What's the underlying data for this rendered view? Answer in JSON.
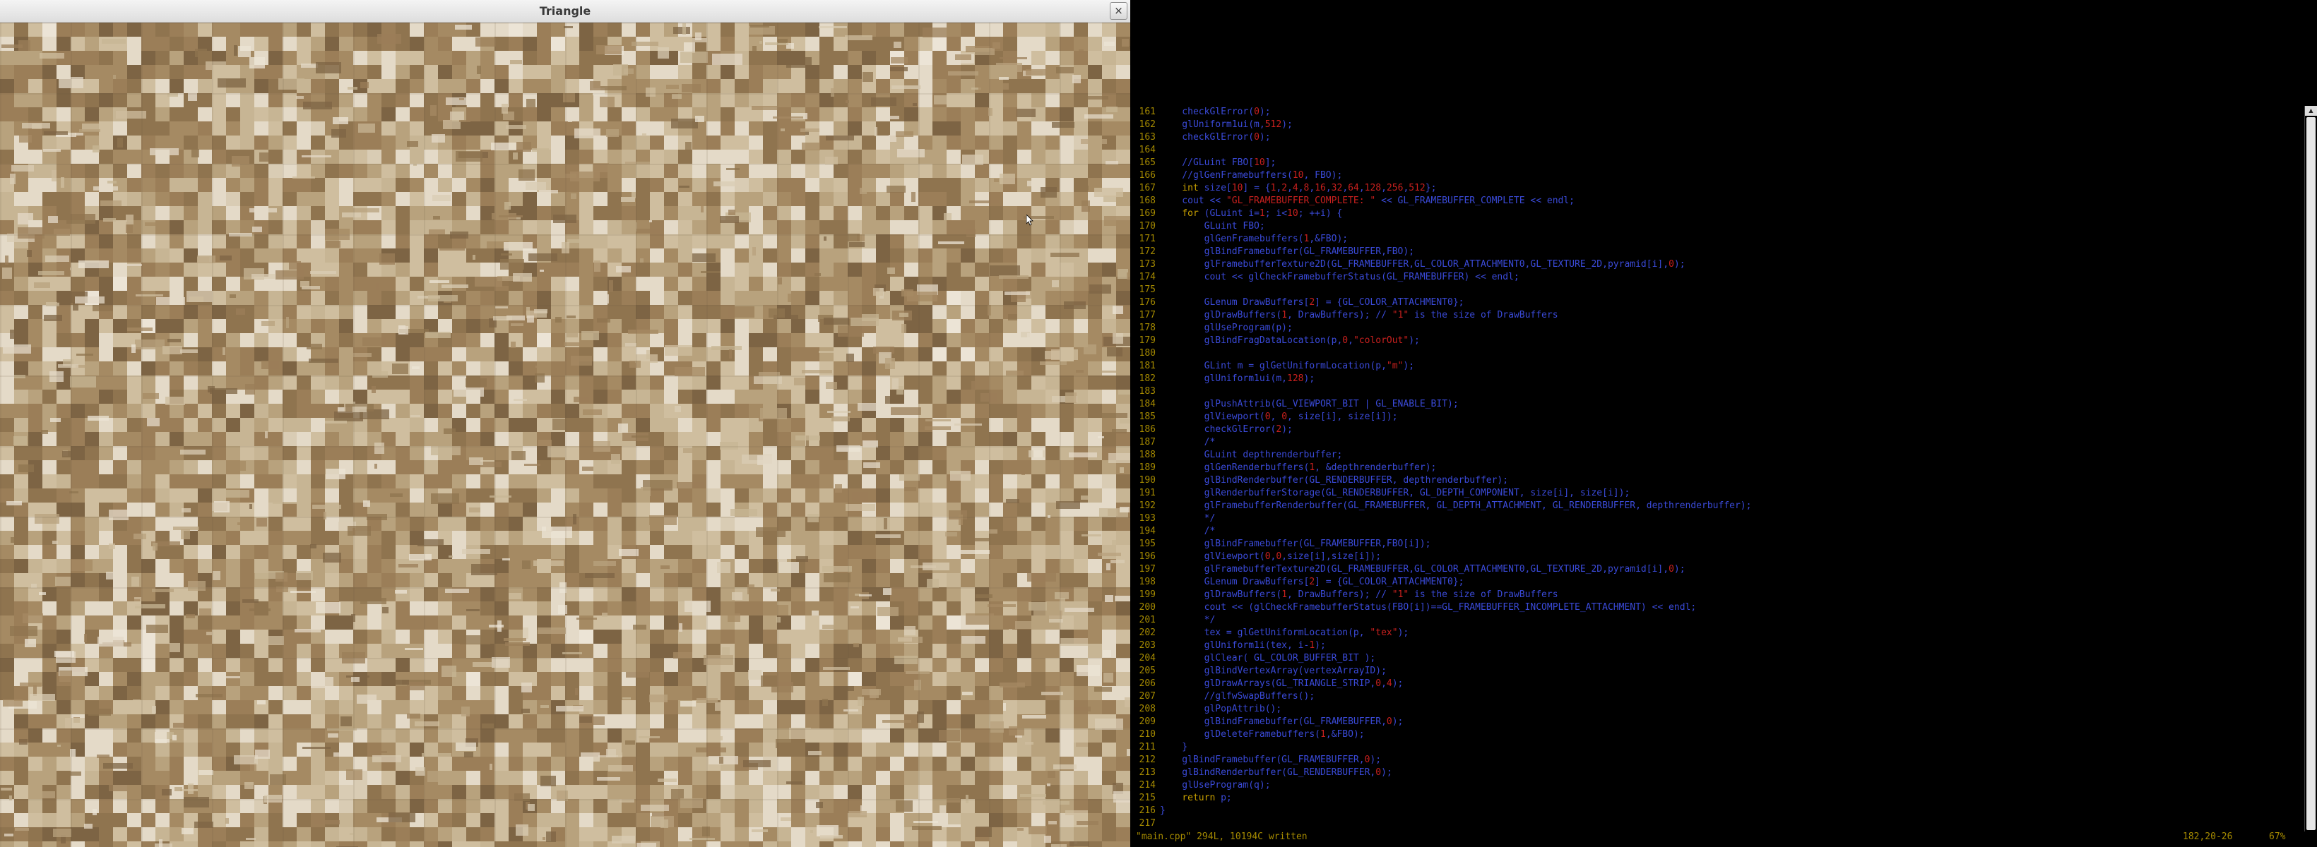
{
  "gl_window": {
    "title": "Triangle",
    "close_glyph": "×",
    "canvas_name": "Rendered texture pyramid output"
  },
  "editor": {
    "lines": [
      {
        "num": "161",
        "text": "    checkGlError(0);"
      },
      {
        "num": "162",
        "text": "    glUniform1ui(m,512);"
      },
      {
        "num": "163",
        "text": "    checkGlError(0);"
      },
      {
        "num": "164",
        "text": ""
      },
      {
        "num": "165",
        "text": "    //GLuint FBO[10];"
      },
      {
        "num": "166",
        "text": "    //glGenFramebuffers(10, FBO);"
      },
      {
        "num": "167",
        "text": "    int size[10] = {1,2,4,8,16,32,64,128,256,512};"
      },
      {
        "num": "168",
        "text": "    cout << \"GL_FRAMEBUFFER_COMPLETE: \" << GL_FRAMEBUFFER_COMPLETE << endl;"
      },
      {
        "num": "169",
        "text": "    for (GLuint i=1; i<10; ++i) {"
      },
      {
        "num": "170",
        "text": "        GLuint FBO;"
      },
      {
        "num": "171",
        "text": "        glGenFramebuffers(1,&FBO);"
      },
      {
        "num": "172",
        "text": "        glBindFramebuffer(GL_FRAMEBUFFER,FBO);"
      },
      {
        "num": "173",
        "text": "        glFramebufferTexture2D(GL_FRAMEBUFFER,GL_COLOR_ATTACHMENT0,GL_TEXTURE_2D,pyramid[i],0);"
      },
      {
        "num": "174",
        "text": "        cout << glCheckFramebufferStatus(GL_FRAMEBUFFER) << endl;"
      },
      {
        "num": "175",
        "text": ""
      },
      {
        "num": "176",
        "text": "        GLenum DrawBuffers[2] = {GL_COLOR_ATTACHMENT0};"
      },
      {
        "num": "177",
        "text": "        glDrawBuffers(1, DrawBuffers); // \"1\" is the size of DrawBuffers"
      },
      {
        "num": "178",
        "text": "        glUseProgram(p);"
      },
      {
        "num": "179",
        "text": "        glBindFragDataLocation(p,0,\"colorOut\");"
      },
      {
        "num": "180",
        "text": ""
      },
      {
        "num": "181",
        "text": "        GLint m = glGetUniformLocation(p,\"m\");"
      },
      {
        "num": "182",
        "text": "        glUniform1ui(m,128);"
      },
      {
        "num": "183",
        "text": ""
      },
      {
        "num": "184",
        "text": "        glPushAttrib(GL_VIEWPORT_BIT | GL_ENABLE_BIT);"
      },
      {
        "num": "185",
        "text": "        glViewport(0, 0, size[i], size[i]);"
      },
      {
        "num": "186",
        "text": "        checkGlError(2);"
      },
      {
        "num": "187",
        "text": "        /*"
      },
      {
        "num": "188",
        "text": "        GLuint depthrenderbuffer;"
      },
      {
        "num": "189",
        "text": "        glGenRenderbuffers(1, &depthrenderbuffer);"
      },
      {
        "num": "190",
        "text": "        glBindRenderbuffer(GL_RENDERBUFFER, depthrenderbuffer);"
      },
      {
        "num": "191",
        "text": "        glRenderbufferStorage(GL_RENDERBUFFER, GL_DEPTH_COMPONENT, size[i], size[i]);"
      },
      {
        "num": "192",
        "text": "        glFramebufferRenderbuffer(GL_FRAMEBUFFER, GL_DEPTH_ATTACHMENT, GL_RENDERBUFFER, depthrenderbuffer);"
      },
      {
        "num": "193",
        "text": "        */"
      },
      {
        "num": "194",
        "text": "        /*"
      },
      {
        "num": "195",
        "text": "        glBindFramebuffer(GL_FRAMEBUFFER,FBO[i]);"
      },
      {
        "num": "196",
        "text": "        glViewport(0,0,size[i],size[i]);"
      },
      {
        "num": "197",
        "text": "        glFramebufferTexture2D(GL_FRAMEBUFFER,GL_COLOR_ATTACHMENT0,GL_TEXTURE_2D,pyramid[i],0);"
      },
      {
        "num": "198",
        "text": "        GLenum DrawBuffers[2] = {GL_COLOR_ATTACHMENT0};"
      },
      {
        "num": "199",
        "text": "        glDrawBuffers(1, DrawBuffers); // \"1\" is the size of DrawBuffers"
      },
      {
        "num": "200",
        "text": "        cout << (glCheckFramebufferStatus(FBO[i])==GL_FRAMEBUFFER_INCOMPLETE_ATTACHMENT) << endl;"
      },
      {
        "num": "201",
        "text": "        */"
      },
      {
        "num": "202",
        "text": "        tex = glGetUniformLocation(p, \"tex\");"
      },
      {
        "num": "203",
        "text": "        glUniform1i(tex, i-1);"
      },
      {
        "num": "204",
        "text": "        glClear( GL_COLOR_BUFFER_BIT );"
      },
      {
        "num": "205",
        "text": "        glBindVertexArray(vertexArrayID);"
      },
      {
        "num": "206",
        "text": "        glDrawArrays(GL_TRIANGLE_STRIP,0,4);"
      },
      {
        "num": "207",
        "text": "        //glfwSwapBuffers();"
      },
      {
        "num": "208",
        "text": "        glPopAttrib();"
      },
      {
        "num": "209",
        "text": "        glBindFramebuffer(GL_FRAMEBUFFER,0);"
      },
      {
        "num": "210",
        "text": "        glDeleteFramebuffers(1,&FBO);"
      },
      {
        "num": "211",
        "text": "    }"
      },
      {
        "num": "212",
        "text": "    glBindFramebuffer(GL_FRAMEBUFFER,0);"
      },
      {
        "num": "213",
        "text": "    glBindRenderbuffer(GL_RENDERBUFFER,0);"
      },
      {
        "num": "214",
        "text": "    glUseProgram(q);"
      },
      {
        "num": "215",
        "text": "    return p;"
      },
      {
        "num": "216",
        "text": "}"
      },
      {
        "num": "217",
        "text": ""
      }
    ],
    "status": {
      "file_info": "\"main.cpp\" 294L, 10194C written",
      "cursor_pos": "182,20-26",
      "percent": "67%"
    }
  },
  "colors": {
    "code_blue": "#3a4ad8",
    "line_number": "#a58a00",
    "string_red": "#c8201e",
    "keyword_yellow": "#c8a000",
    "comment": "#4a5ae8"
  }
}
